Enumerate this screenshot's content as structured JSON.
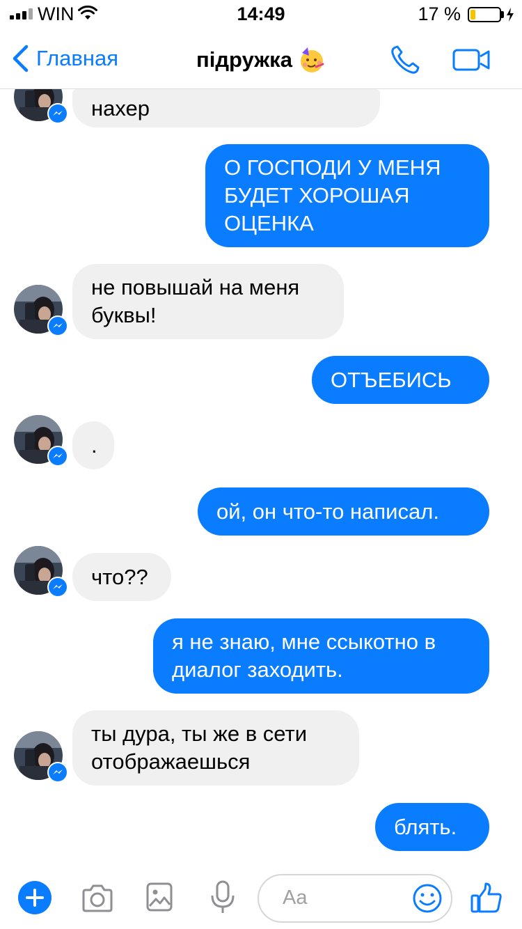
{
  "status_bar": {
    "carrier": "WIN",
    "time": "14:49",
    "battery_percent": "17 %",
    "battery_level": 0.17,
    "icons": [
      "signal-icon",
      "wifi-icon",
      "battery-icon",
      "charging-bolt-icon"
    ]
  },
  "nav": {
    "back_label": "Главная",
    "title": "підружка",
    "title_emoji": "partying-face-emoji",
    "icons": [
      "chevron-left-icon",
      "phone-icon",
      "video-camera-icon"
    ]
  },
  "messages": [
    {
      "dir": "in",
      "text": "нахер"
    },
    {
      "dir": "out",
      "text": "О ГОСПОДИ У МЕНЯ БУДЕТ ХОРОШАЯ ОЦЕНКА"
    },
    {
      "dir": "in",
      "text": "не повышай на меня буквы!"
    },
    {
      "dir": "out",
      "text": "ОТЪЕБИСЬ"
    },
    {
      "dir": "in",
      "text": "."
    },
    {
      "dir": "out",
      "text": "ой, он что-то написал."
    },
    {
      "dir": "in",
      "text": "что??"
    },
    {
      "dir": "out",
      "text": "я не знаю, мне ссыкотно в диалог заходить."
    },
    {
      "dir": "in",
      "text": "ты дура, ты же в сети отображаешься"
    },
    {
      "dir": "out",
      "text": "блять."
    }
  ],
  "composer": {
    "placeholder": "Aa",
    "icons": [
      "plus-icon",
      "camera-icon",
      "photo-icon",
      "microphone-icon",
      "smiley-icon",
      "thumbs-up-icon"
    ]
  },
  "colors": {
    "accent": "#0a7cff",
    "incoming_bubble": "#f1f0f0",
    "battery_fill": "#f5c400"
  }
}
